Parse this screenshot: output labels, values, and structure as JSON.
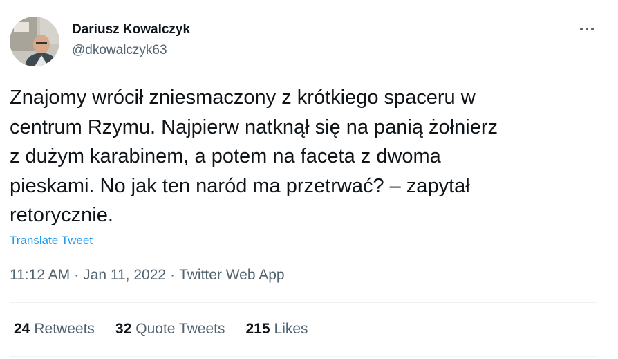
{
  "author": {
    "name": "Dariusz Kowalczyk",
    "handle": "@dkowalczyk63"
  },
  "tweet": {
    "text": "Znajomy wrócił zniesmaczony z krótkiego spaceru w\ncentrum Rzymu. Najpierw natknął się na panią żołnierz\nz dużym karabinem, a potem na faceta z dwoma\npieskami. No jak ten naród ma przetrwać? – zapytał\nretorycznie.",
    "translate_label": "Translate Tweet",
    "time": "11:12 AM",
    "date": "Jan 11, 2022",
    "source": "Twitter Web App"
  },
  "stats": {
    "retweets_count": "24",
    "retweets_label": "Retweets",
    "quote_count": "32",
    "quote_label": "Quote Tweets",
    "likes_count": "215",
    "likes_label": "Likes"
  },
  "colors": {
    "text": "#0f1419",
    "secondary": "#536471",
    "link": "#1d9bf0",
    "divider": "#eff3f4"
  },
  "icons": {
    "more": "more-horizontal-icon"
  }
}
